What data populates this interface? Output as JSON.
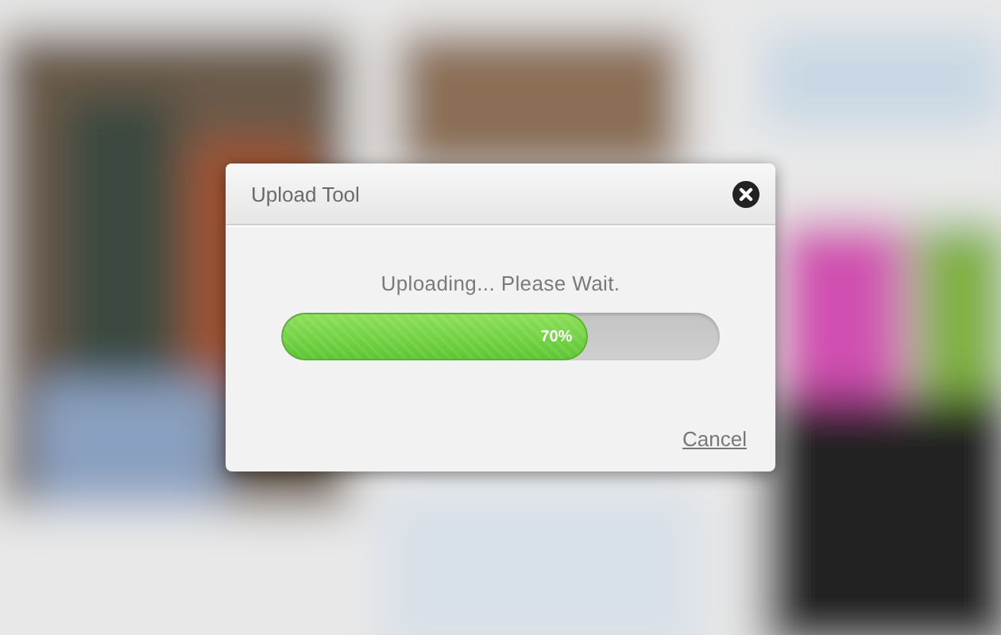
{
  "dialog": {
    "title": "Upload Tool",
    "message": "Uploading... Please Wait.",
    "progress": {
      "level": 0.7,
      "reading": "70%"
    },
    "cancel_link": "Cancel"
  }
}
